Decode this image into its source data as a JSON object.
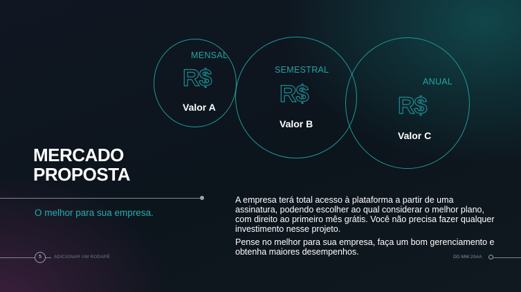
{
  "plans": [
    {
      "label": "MENSAL",
      "currency": "R$",
      "value": "Valor A"
    },
    {
      "label": "SEMESTRAL",
      "currency": "R$",
      "value": "Valor B"
    },
    {
      "label": "ANUAL",
      "currency": "R$",
      "value": "Valor C"
    }
  ],
  "title": {
    "line1": "MERCADO",
    "line2": "PROPOSTA"
  },
  "subtitle": "O melhor para sua empresa.",
  "body": {
    "paragraph1": "A empresa terá total acesso à plataforma a partir de uma assinatura, podendo escolher ao qual considerar o melhor plano, com direito ao primeiro mês grátis. Você não precisa fazer qualquer investimento nesse projeto.",
    "paragraph2": "Pense no melhor para sua empresa, faça um bom gerenciamento e obtenha maiores desempenhos."
  },
  "footer": {
    "page_number": "5",
    "text": "ADICIONAR UM RODAPÉ",
    "date": "DD.MM.20AA"
  },
  "colors": {
    "accent": "#1d9c9c",
    "background": "#0f1620"
  }
}
